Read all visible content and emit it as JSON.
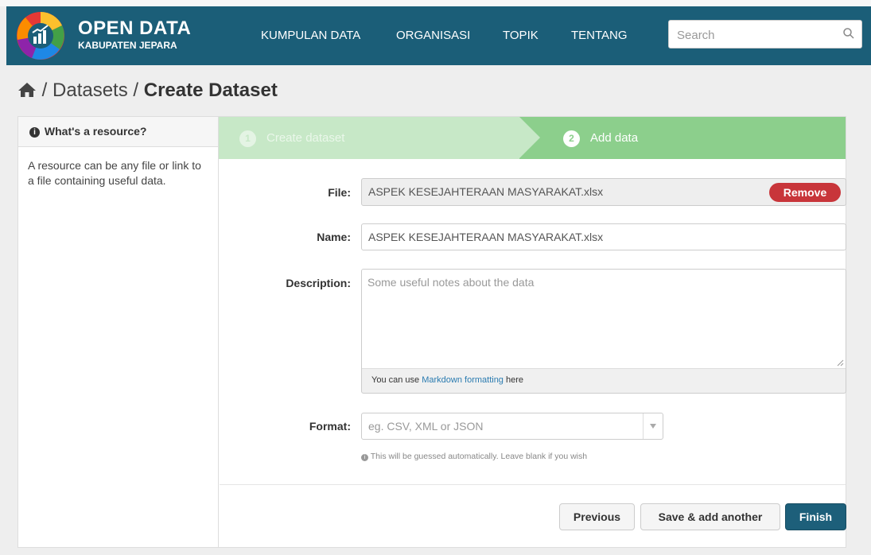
{
  "brand": {
    "title": "OPEN DATA",
    "subtitle": "KABUPATEN JEPARA"
  },
  "nav": {
    "items": [
      "KUMPULAN DATA",
      "ORGANISASI",
      "TOPIK",
      "TENTANG"
    ]
  },
  "search": {
    "placeholder": "Search"
  },
  "breadcrumb": {
    "datasets": "Datasets",
    "current": "Create Dataset",
    "sep": "/"
  },
  "sidebar": {
    "heading": "What's a resource?",
    "body": "A resource can be any file or link to a file containing useful data."
  },
  "stages": [
    {
      "num": "1",
      "label": "Create dataset"
    },
    {
      "num": "2",
      "label": "Add data"
    }
  ],
  "form": {
    "file_label": "File:",
    "file_value": "ASPEK KESEJAHTERAAN MASYARAKAT.xlsx",
    "remove_label": "Remove",
    "name_label": "Name:",
    "name_value": "ASPEK KESEJAHTERAAN MASYARAKAT.xlsx",
    "description_label": "Description:",
    "description_placeholder": "Some useful notes about the data",
    "markdown_prefix": "You can use",
    "markdown_link": "Markdown formatting",
    "markdown_suffix": "here",
    "format_label": "Format:",
    "format_placeholder": "eg. CSV, XML or JSON",
    "format_help": "This will be guessed automatically. Leave blank if you wish"
  },
  "actions": {
    "previous": "Previous",
    "save_add": "Save & add another",
    "finish": "Finish"
  },
  "colors": {
    "navbar": "#1b5e78",
    "stage_active": "#8ccf8c",
    "stage_done": "#c7e8c7",
    "remove": "#c8353a",
    "finish": "#1d5f7a",
    "link": "#2a7bb0"
  }
}
